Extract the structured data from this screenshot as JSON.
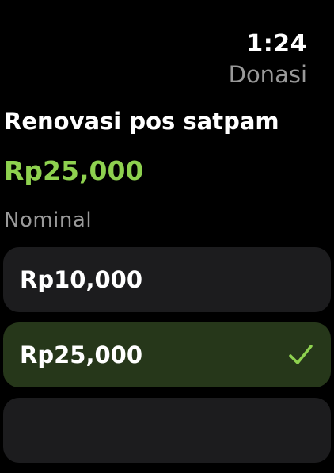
{
  "status": {
    "time": "1:24",
    "app_title": "Donasi"
  },
  "campaign": {
    "title": "Renovasi pos satpam",
    "amount": "Rp25,000"
  },
  "nominal": {
    "label": "Nominal",
    "options": [
      {
        "label": "Rp10,000",
        "selected": false
      },
      {
        "label": "Rp25,000",
        "selected": true
      }
    ]
  },
  "colors": {
    "accent": "#8ed14f",
    "selected_bg": "#26371a",
    "option_bg": "#1c1c1e"
  },
  "icons": {
    "selected_marker": "checkmark-icon"
  }
}
